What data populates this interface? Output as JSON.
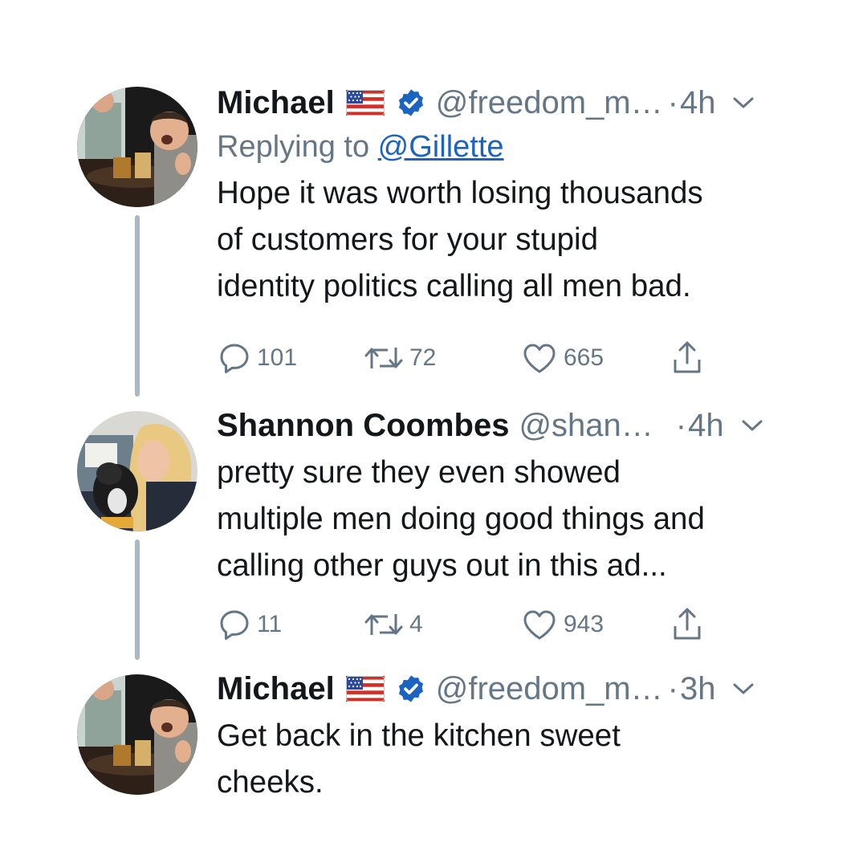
{
  "colors": {
    "text_primary": "#14171a",
    "text_secondary": "#657786",
    "link": "#1b63c0",
    "verified": "#1b63c0",
    "thread_line": "#aab8c2"
  },
  "tweets": [
    {
      "name": "Michael",
      "flag_icon": "us-flag-icon",
      "verified_icon": "verified-badge-icon",
      "handle": "@freedom_m…",
      "dot": "·",
      "time": "4h",
      "reply_prefix": "Replying to ",
      "reply_to": "@Gillette",
      "body": "Hope it was worth losing thousands\nof customers for your stupid\nidentity politics calling all men bad.",
      "replies": "101",
      "retweets": "72",
      "likes": "665"
    },
    {
      "name": "Shannon Coombes",
      "handle": "@shan…",
      "dot": "·",
      "time": "4h",
      "body": "pretty sure they even showed\nmultiple men doing good things and\ncalling other guys out in this ad...",
      "replies": "11",
      "retweets": "4",
      "likes": "943"
    },
    {
      "name": "Michael",
      "flag_icon": "us-flag-icon",
      "verified_icon": "verified-badge-icon",
      "handle": "@freedom_m…",
      "dot": "·",
      "time": "3h",
      "body": "Get back in the kitchen sweet\ncheeks."
    }
  ]
}
